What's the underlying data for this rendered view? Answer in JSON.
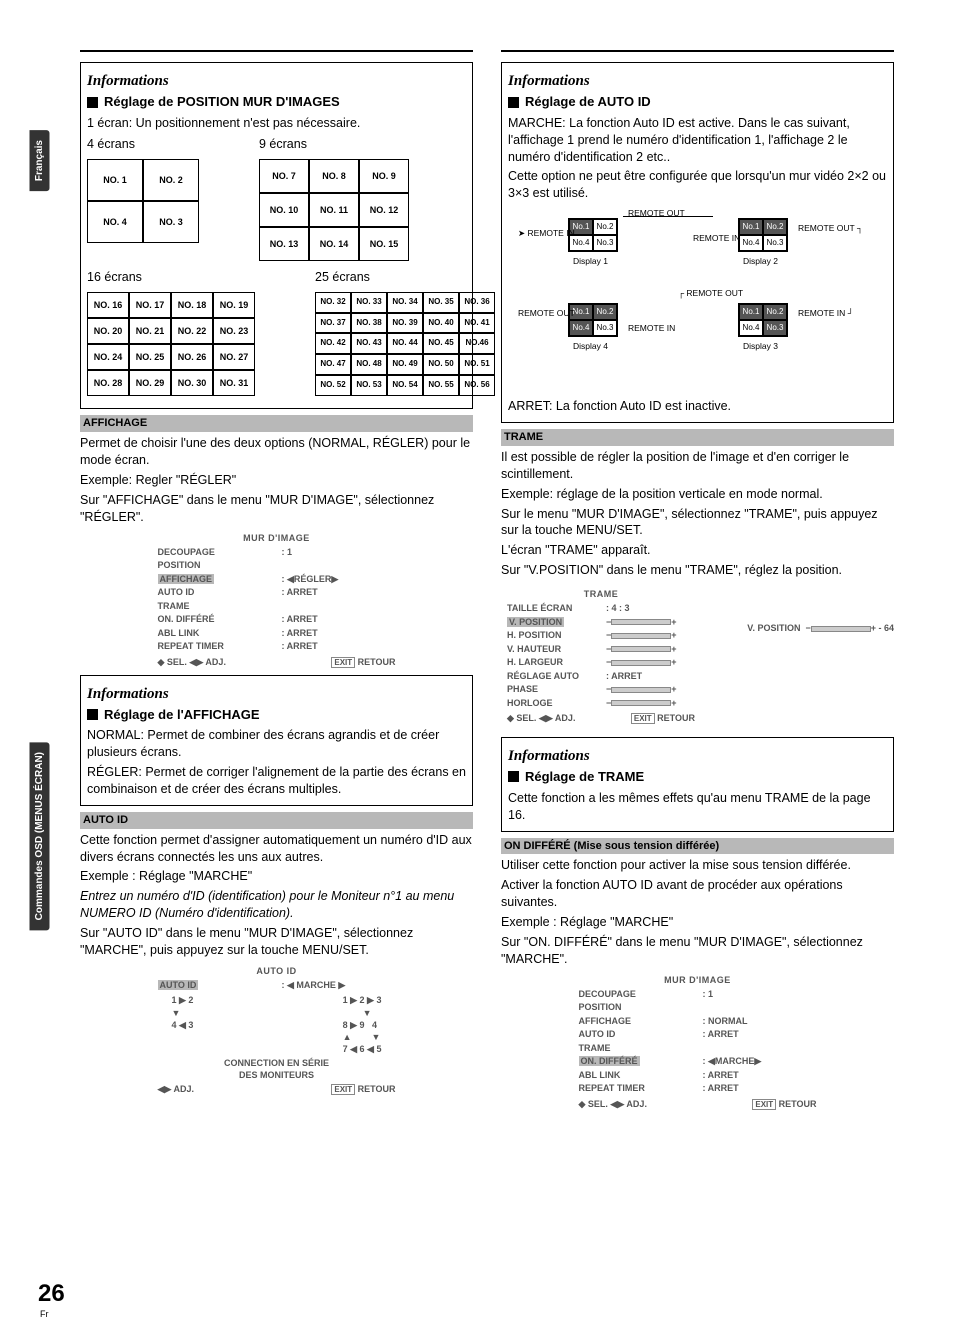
{
  "sidebar": {
    "lang": "Français",
    "section": "Commandes OSD (MENUS ÉCRAN)"
  },
  "page_number": "26",
  "page_number_sub": "Fr",
  "left": {
    "info1_heading": "Informations",
    "info1_sub": "Réglage de POSITION MUR D'IMAGES",
    "screen1_line": "1 écran: Un positionnement n'est pas nécessaire.",
    "label_4": "4 écrans",
    "label_9": "9 écrans",
    "label_16": "16 écrans",
    "label_25": "25 écrans",
    "grid4": [
      "NO. 1",
      "NO. 2",
      "NO. 4",
      "NO. 3"
    ],
    "grid9": [
      "NO. 7",
      "NO. 8",
      "NO. 9",
      "NO. 10",
      "NO. 11",
      "NO. 12",
      "NO. 13",
      "NO. 14",
      "NO. 15"
    ],
    "grid16": [
      "NO. 16",
      "NO. 17",
      "NO. 18",
      "NO. 19",
      "NO. 20",
      "NO. 21",
      "NO. 22",
      "NO. 23",
      "NO. 24",
      "NO. 25",
      "NO. 26",
      "NO. 27",
      "NO. 28",
      "NO. 29",
      "NO. 30",
      "NO. 31"
    ],
    "grid25": [
      "NO. 32",
      "NO. 33",
      "NO. 34",
      "NO. 35",
      "NO. 36",
      "NO. 37",
      "NO. 38",
      "NO. 39",
      "NO. 40",
      "NO. 41",
      "NO. 42",
      "NO. 43",
      "NO. 44",
      "NO. 45",
      "NO.46",
      "NO. 47",
      "NO. 48",
      "NO. 49",
      "NO. 50",
      "NO. 51",
      "NO. 52",
      "NO. 53",
      "NO. 54",
      "NO. 55",
      "NO. 56"
    ],
    "affichage_head": "AFFICHAGE",
    "affichage_p1": "Permet de choisir l'une des deux options (NORMAL, RÉGLER) pour le mode écran.",
    "affichage_ex": "Exemple: Regler \"RÉGLER\"",
    "affichage_p2": "Sur \"AFFICHAGE\" dans le menu \"MUR D'IMAGE\", sélectionnez \"RÉGLER\".",
    "osd1": {
      "title": "MUR D'IMAGE",
      "rows": [
        {
          "k": "DECOUPAGE",
          "v": ":   1"
        },
        {
          "k": "POSITION",
          "v": ""
        },
        {
          "k": "AFFICHAGE",
          "v": ": ◀RÉGLER▶",
          "hl": true
        },
        {
          "k": "AUTO ID",
          "v": ":   ARRET"
        },
        {
          "k": "TRAME",
          "v": ""
        },
        {
          "k": "ON. DIFFÉRÉ",
          "v": ":   ARRET"
        },
        {
          "k": "ABL LINK",
          "v": ":   ARRET"
        },
        {
          "k": "REPEAT TIMER",
          "v": ":   ARRET"
        }
      ],
      "foot_l": "◆ SEL.    ◀▶ ADJ.",
      "foot_r": "EXIT RETOUR"
    },
    "info2_heading": "Informations",
    "info2_sub": "Réglage de l'AFFICHAGE",
    "info2_p1": "NORMAL: Permet de combiner des écrans agrandis et de créer plusieurs écrans.",
    "info2_p2": "RÉGLER: Permet de corriger l'alignement de la partie des écrans en combinaison et de créer des écrans multiples.",
    "autoid_head": "AUTO ID",
    "autoid_p1": "Cette fonction permet d'assigner automatiquement un numéro d'ID aux divers écrans connectés les uns aux autres.",
    "autoid_ex": "Exemple : Réglage \"MARCHE\"",
    "autoid_note": "Entrez un numéro d'ID (identification) pour le Moniteur n°1 au menu NUMERO ID (Numéro d'identification).",
    "autoid_p2": "Sur \"AUTO ID\" dans le menu \"MUR D'IMAGE\", sélectionnez \"MARCHE\", puis appuyez sur la touche MENU/SET.",
    "osd2": {
      "title": "AUTO ID",
      "row1_k": "AUTO ID",
      "row1_v": ": ◀ MARCHE ▶",
      "conn1": "CONNECTION EN SÉRIE",
      "conn2": "DES MONITEURS",
      "foot_l": "◀▶ ADJ.",
      "foot_r": "EXIT RETOUR"
    }
  },
  "right": {
    "info1_heading": "Informations",
    "info1_sub": "Réglage de AUTO ID",
    "p1": "MARCHE: La fonction Auto ID est active. Dans le cas suivant, l'affichage 1 prend le numéro d'identification 1, l'affichage 2 le numéro d'identification 2 etc..",
    "p2": "Cette option ne peut être configurée que lorsqu'un mur vidéo 2×2 ou 3×3 est utilisé.",
    "diagram": {
      "d1": "Display 1",
      "d2": "Display 2",
      "d3": "Display 3",
      "d4": "Display 4",
      "cells": [
        "No.1",
        "No.2",
        "No.4",
        "No.3"
      ],
      "rin": "REMOTE IN",
      "rout": "REMOTE OUT"
    },
    "arret_line": "ARRET: La fonction Auto ID est inactive.",
    "trame_head": "TRAME",
    "trame_p1": "Il est possible de régler la position de l'image et d'en corriger le scintillement.",
    "trame_ex": "Exemple: réglage de la position verticale en mode normal.",
    "trame_p2": "Sur le menu \"MUR D'IMAGE\", sélectionnez \"TRAME\", puis appuyez sur la touche MENU/SET.",
    "trame_p3": "L'écran \"TRAME\" apparaît.",
    "trame_p4": "Sur \"V.POSITION\" dans le menu \"TRAME\", réglez la position.",
    "osd3": {
      "title": "TRAME",
      "rows": [
        {
          "k": "TAILLE ÉCRAN",
          "v": ":   4 : 3"
        },
        {
          "k": "V. POSITION",
          "v": "",
          "hl": true,
          "slider": true
        },
        {
          "k": "H. POSITION",
          "v": "",
          "slider": true
        },
        {
          "k": "V. HAUTEUR",
          "v": "",
          "slider": true
        },
        {
          "k": "H. LARGEUR",
          "v": "",
          "slider": true
        },
        {
          "k": "RÉGLAGE AUTO",
          "v": ":   ARRET"
        },
        {
          "k": "PHASE",
          "v": "",
          "slider": true
        },
        {
          "k": "HORLOGE",
          "v": "",
          "slider": true
        }
      ],
      "foot_l": "◆ SEL.    ◀▶ ADJ.",
      "foot_r": "EXIT RETOUR",
      "side_k": "V. POSITION",
      "side_v": "- 64"
    },
    "info2_heading": "Informations",
    "info2_sub": "Réglage de TRAME",
    "info2_p1": "Cette fonction a les mêmes effets qu'au menu TRAME de la page 16.",
    "ondiff_head": "ON DIFFÉRÉ (Mise sous tension différée)",
    "ondiff_p1": "Utiliser cette fonction pour activer la mise sous tension différée.",
    "ondiff_p2": "Activer la fonction AUTO ID avant de procéder aux opérations suivantes.",
    "ondiff_ex": "Exemple : Réglage \"MARCHE\"",
    "ondiff_p3": "Sur \"ON. DIFFÉRÉ\" dans le menu \"MUR D'IMAGE\", sélectionnez \"MARCHE\".",
    "osd4": {
      "title": "MUR D'IMAGE",
      "rows": [
        {
          "k": "DECOUPAGE",
          "v": ":   1"
        },
        {
          "k": "POSITION",
          "v": ""
        },
        {
          "k": "AFFICHAGE",
          "v": ":   NORMAL"
        },
        {
          "k": "AUTO ID",
          "v": ":   ARRET"
        },
        {
          "k": "TRAME",
          "v": ""
        },
        {
          "k": "ON. DIFFÉRÉ",
          "v": ": ◀MARCHE▶",
          "hl": true
        },
        {
          "k": "ABL LINK",
          "v": ":   ARRET"
        },
        {
          "k": "REPEAT TIMER",
          "v": ":   ARRET"
        }
      ],
      "foot_l": "◆ SEL.    ◀▶ ADJ.",
      "foot_r": "EXIT RETOUR"
    }
  }
}
